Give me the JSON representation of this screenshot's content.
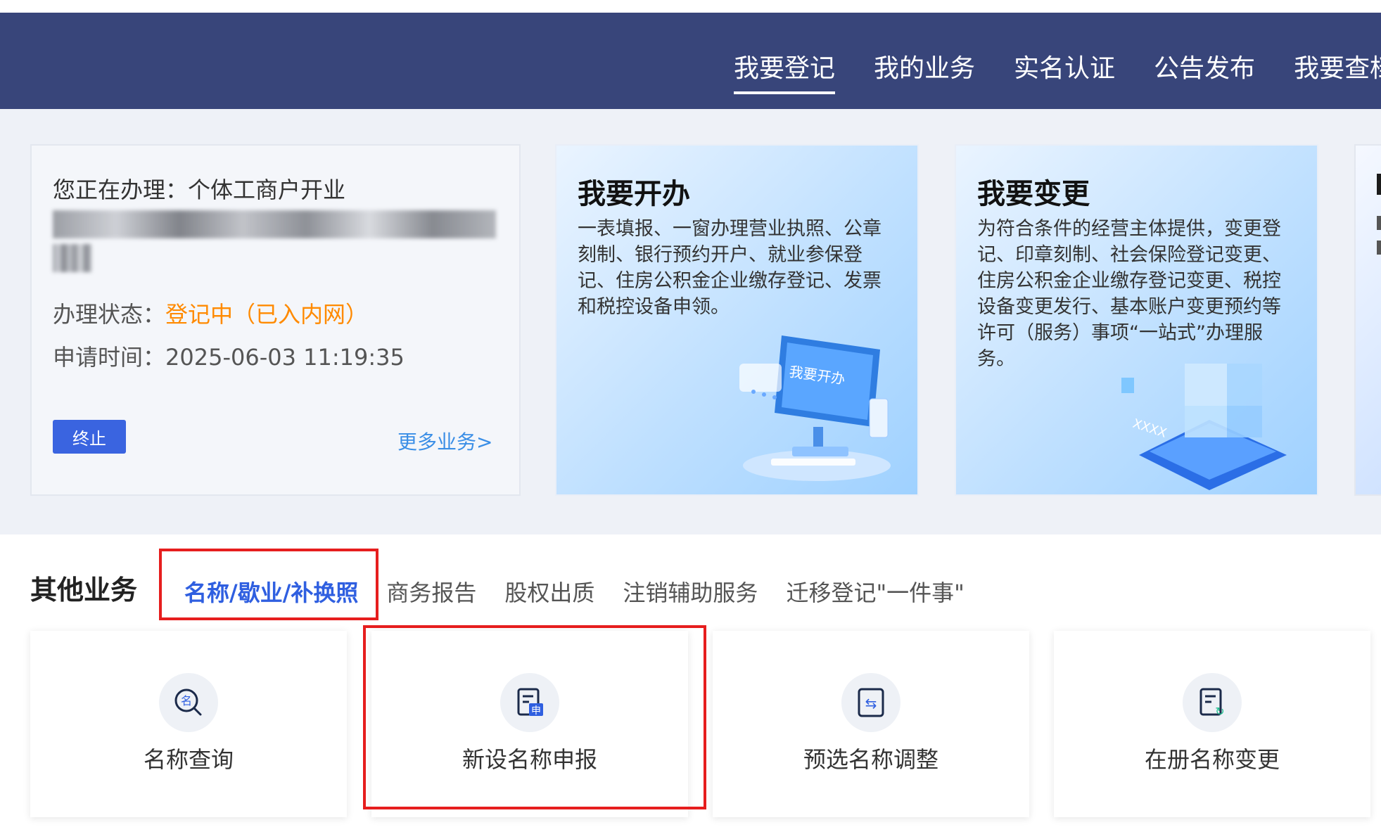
{
  "nav": {
    "items": [
      {
        "label": "我要登记",
        "active": true
      },
      {
        "label": "我的业务",
        "active": false
      },
      {
        "label": "实名认证",
        "active": false
      },
      {
        "label": "公告发布",
        "active": false
      },
      {
        "label": "我要查档",
        "active": false
      }
    ]
  },
  "current": {
    "title": "您正在办理：个体工商户开业",
    "status_label": "办理状态：",
    "status_value": "登记中（已入内网）",
    "time_label": "申请时间：",
    "time_value": "2025-06-03 11:19:35",
    "stop_button": "终止",
    "more_link": "更多业务>"
  },
  "promos": [
    {
      "title": "我要开办",
      "desc": "一表填报、一窗办理营业执照、公章刻制、银行预约开户、就业参保登记、住房公积金企业缴存登记、发票和税控设备申领。",
      "illustration_text": "我要开办"
    },
    {
      "title": "我要变更",
      "desc": "为符合条件的经营主体提供，变更登记、印章刻制、社会保险登记变更、住房公积金企业缴存登记变更、税控设备变更发行、基本账户变更预约等许可（服务）事项“一站式”办理服务。",
      "illustration_text": "XXXX"
    }
  ],
  "other": {
    "title": "其他业务",
    "tabs": [
      {
        "label": "名称/歇业/补换照",
        "active": true
      },
      {
        "label": "商务报告",
        "active": false
      },
      {
        "label": "股权出质",
        "active": false
      },
      {
        "label": "注销辅助服务",
        "active": false
      },
      {
        "label": "迁移登记\"一件事\"",
        "active": false
      }
    ],
    "services": [
      {
        "label": "名称查询",
        "icon": "name-search-icon",
        "glyph": "名"
      },
      {
        "label": "新设名称申报",
        "icon": "name-apply-icon",
        "glyph": "申"
      },
      {
        "label": "预选名称调整",
        "icon": "name-adjust-icon",
        "glyph": "⇆"
      },
      {
        "label": "在册名称变更",
        "icon": "name-change-icon",
        "glyph": "↻"
      }
    ]
  },
  "colors": {
    "header": "#38457a",
    "accent": "#3a64e0",
    "status": "#ff8a00",
    "highlight": "#e61e1e"
  }
}
